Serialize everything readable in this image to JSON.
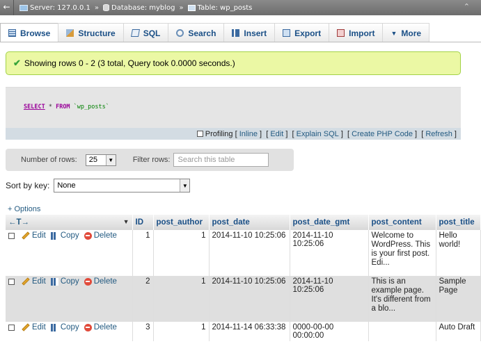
{
  "breadcrumb": {
    "server": "Server: 127.0.0.1",
    "database": "Database: myblog",
    "table": "Table: wp_posts"
  },
  "tabs": [
    {
      "label": "Browse",
      "icon": "browse-icon"
    },
    {
      "label": "Structure",
      "icon": "structure-icon"
    },
    {
      "label": "SQL",
      "icon": "sql-icon"
    },
    {
      "label": "Search",
      "icon": "search-icon"
    },
    {
      "label": "Insert",
      "icon": "insert-icon"
    },
    {
      "label": "Export",
      "icon": "export-icon"
    },
    {
      "label": "Import",
      "icon": "import-icon"
    },
    {
      "label": "More",
      "icon": "chevron-down-icon"
    }
  ],
  "notice": "Showing rows 0 - 2 (3 total, Query took 0.0000 seconds.)",
  "sql": {
    "select_kw": "SELECT",
    "star": " * ",
    "from_kw": "FROM",
    "table": " `wp_posts`",
    "profiling": "Profiling",
    "links": [
      "Inline",
      "Edit",
      "Explain SQL",
      "Create PHP Code",
      "Refresh"
    ]
  },
  "nav": {
    "rows_label": "Number of rows:",
    "rows_value": "25",
    "filter_label": "Filter rows:",
    "filter_placeholder": "Search this table"
  },
  "sort": {
    "label": "Sort by key:",
    "value": "None"
  },
  "options_link": "+ Options",
  "table": {
    "headers": {
      "arrows": "←T→",
      "id": "ID",
      "post_author": "post_author",
      "post_date": "post_date",
      "post_date_gmt": "post_date_gmt",
      "post_content": "post_content",
      "post_title": "post_title"
    },
    "action_labels": {
      "edit": "Edit",
      "copy": "Copy",
      "delete": "Delete"
    },
    "rows": [
      {
        "id": "1",
        "post_author": "1",
        "post_date": "2014-11-10 10:25:06",
        "post_date_gmt": "2014-11-10 10:25:06",
        "post_content": "Welcome to WordPress. This is your first post. Edi...",
        "post_title": "Hello world!"
      },
      {
        "id": "2",
        "post_author": "1",
        "post_date": "2014-11-10 10:25:06",
        "post_date_gmt": "2014-11-10 10:25:06",
        "post_content": "This is an example page. It's different from a blo...",
        "post_title": "Sample Page"
      },
      {
        "id": "3",
        "post_author": "1",
        "post_date": "2014-11-14 06:33:38",
        "post_date_gmt": "0000-00-00 00:00:00",
        "post_content": "",
        "post_title": "Auto Draft"
      }
    ]
  }
}
